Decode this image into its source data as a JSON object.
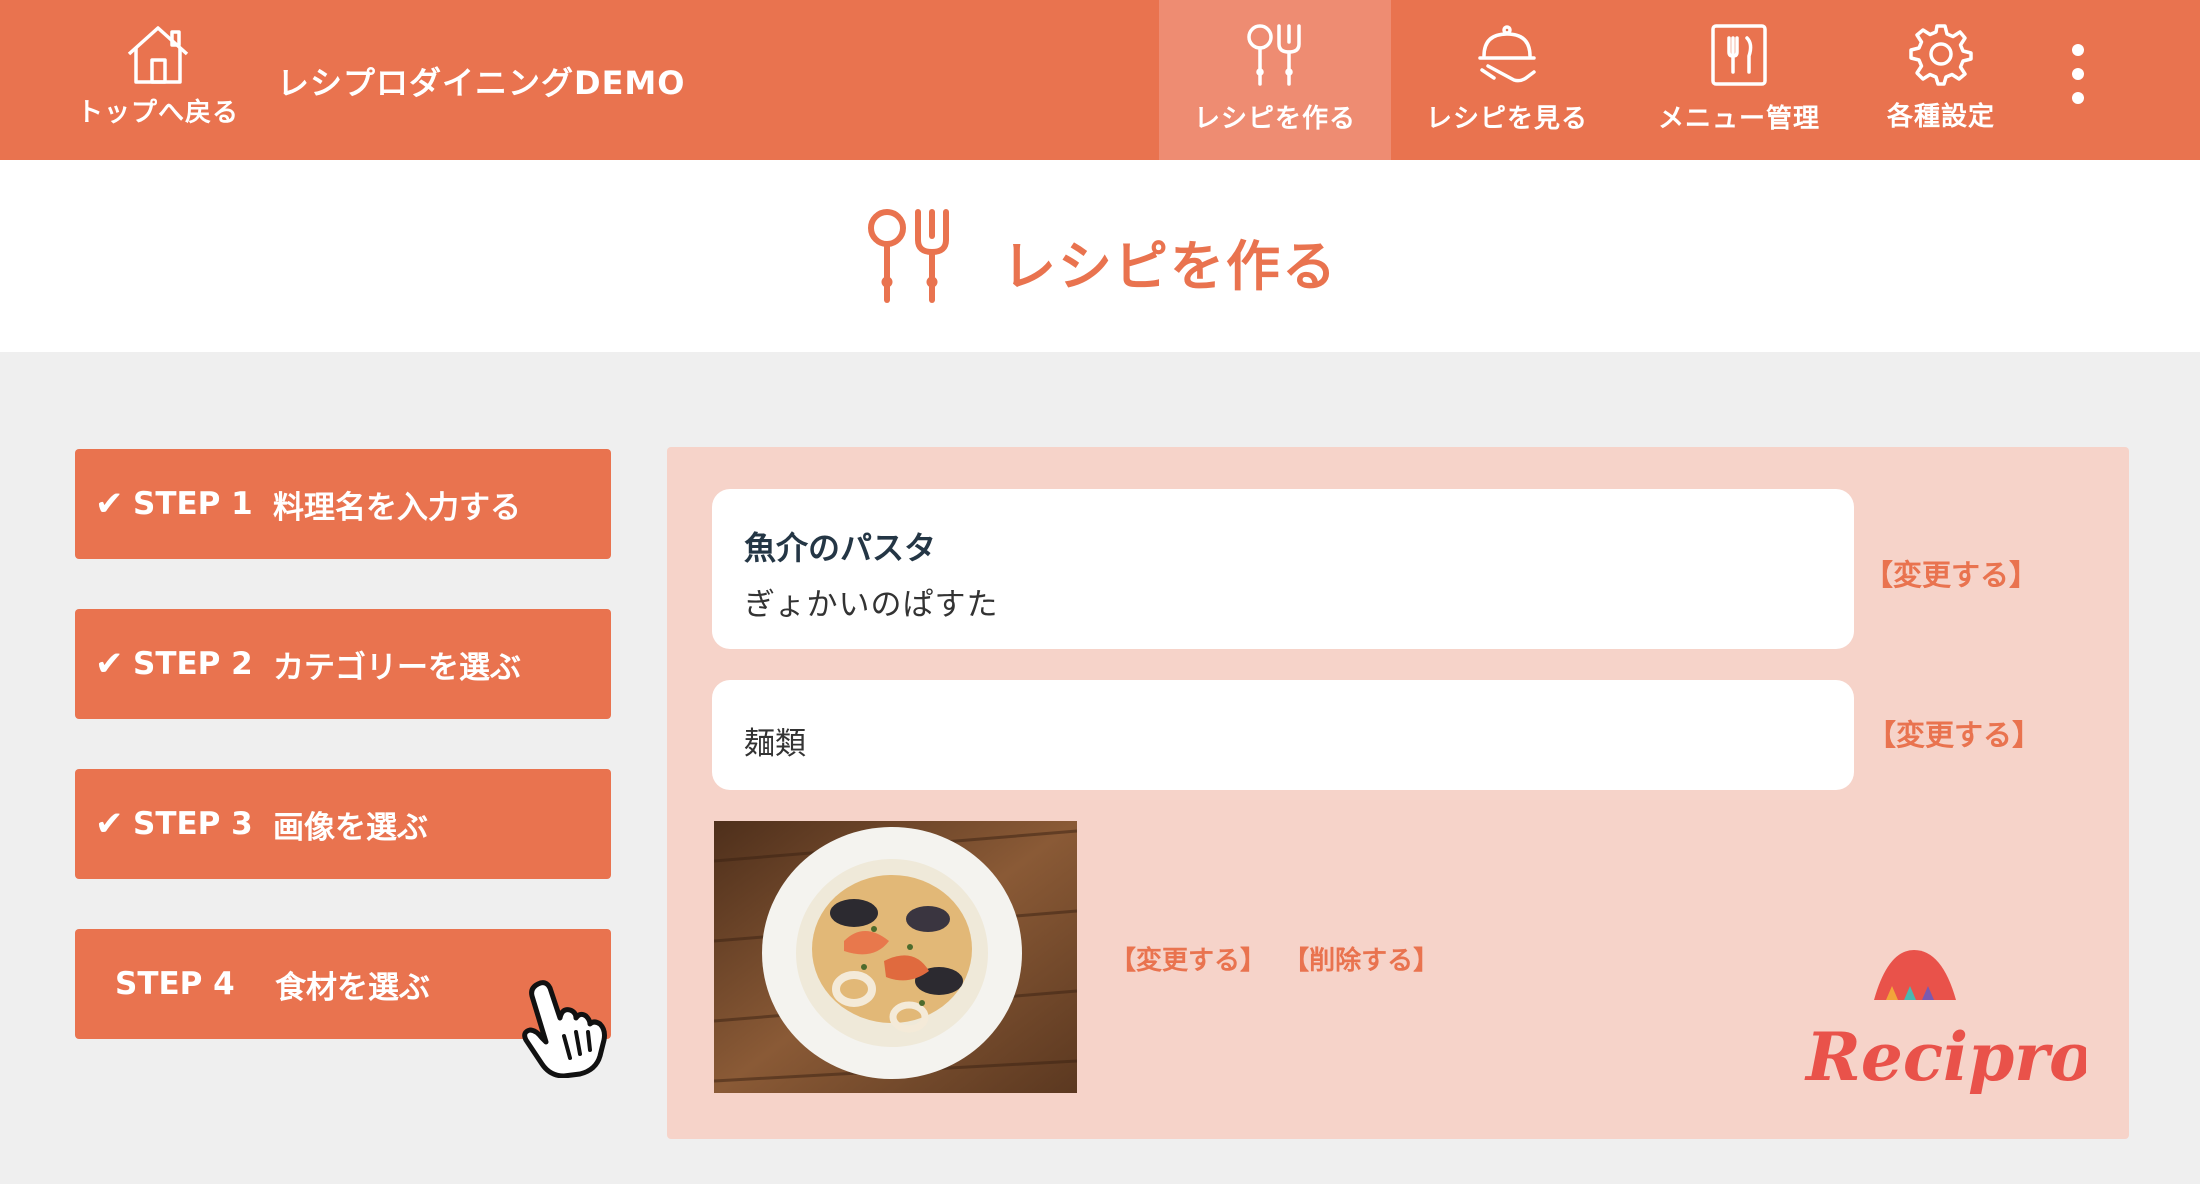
{
  "header": {
    "home_label": "トップへ戻る",
    "app_title": "レシプロダイニングDEMO",
    "nav": [
      {
        "label": "レシピを作る",
        "icon": "spoon-fork-icon",
        "active": true
      },
      {
        "label": "レシピを見る",
        "icon": "cloche-icon",
        "active": false
      },
      {
        "label": "メニュー管理",
        "icon": "menu-card-icon",
        "active": false
      },
      {
        "label": "各種設定",
        "icon": "gear-icon",
        "active": false
      }
    ]
  },
  "page": {
    "title": "レシピを作る",
    "title_icon": "spoon-fork-icon"
  },
  "steps": [
    {
      "check": "✔",
      "number": "STEP 1",
      "label": "料理名を入力する",
      "done": true
    },
    {
      "check": "✔",
      "number": "STEP 2",
      "label": "カテゴリーを選ぶ",
      "done": true
    },
    {
      "check": "✔",
      "number": "STEP 3",
      "label": "画像を選ぶ",
      "done": true
    },
    {
      "check": "",
      "number": "STEP 4",
      "label": "食材を選ぶ",
      "done": false
    }
  ],
  "summary": {
    "dish_name": "魚介のパスタ",
    "dish_kana": "ぎょかいのぱすた",
    "category": "麺類",
    "change_label": "【変更する】",
    "delete_label": "【削除する】"
  },
  "logo_text": "Recipro",
  "colors": {
    "accent": "#e9734f",
    "accent_light": "#ee8c72",
    "panel_bg": "#f6d3c9",
    "page_bg": "#efefef",
    "text_dark": "#243645"
  }
}
